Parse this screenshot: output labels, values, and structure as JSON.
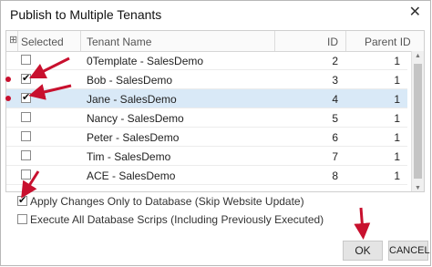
{
  "window": {
    "title": "Publish to Multiple Tenants",
    "close_symbol": "✕"
  },
  "grid": {
    "columns": {
      "selector": "",
      "selected": "Selected",
      "tenant_name": "Tenant Name",
      "id": "ID",
      "parent_id": "Parent ID"
    },
    "rows": [
      {
        "checked": false,
        "name": "0Template - SalesDemo",
        "id": "2",
        "parent_id": "1"
      },
      {
        "checked": true,
        "name": "Bob - SalesDemo",
        "id": "3",
        "parent_id": "1"
      },
      {
        "checked": true,
        "name": "Jane - SalesDemo",
        "id": "4",
        "parent_id": "1"
      },
      {
        "checked": false,
        "name": "Nancy - SalesDemo",
        "id": "5",
        "parent_id": "1"
      },
      {
        "checked": false,
        "name": "Peter - SalesDemo",
        "id": "6",
        "parent_id": "1"
      },
      {
        "checked": false,
        "name": "Tim - SalesDemo",
        "id": "7",
        "parent_id": "1"
      },
      {
        "checked": false,
        "name": "ACE - SalesDemo",
        "id": "8",
        "parent_id": "1"
      }
    ],
    "selected_row_index": 2
  },
  "options": [
    {
      "checked": true,
      "label": "Apply Changes Only to Database (Skip Website Update)"
    },
    {
      "checked": false,
      "label": "Execute All Database Scrips (Including Previously Executed)"
    }
  ],
  "buttons": {
    "ok": "OK",
    "cancel": "CANCEL"
  },
  "annotation_color": "#c8102e"
}
